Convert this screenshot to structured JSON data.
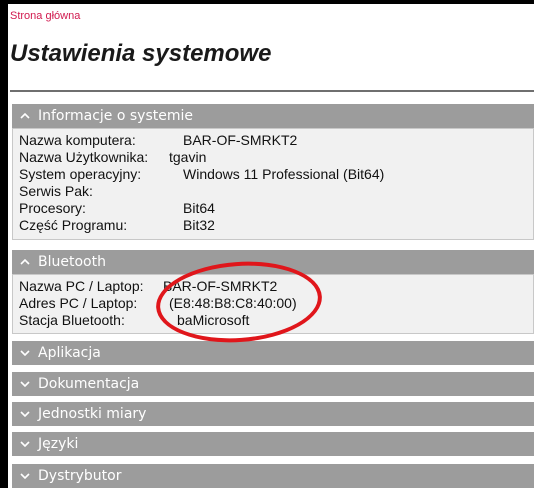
{
  "breadcrumb": "Strona główna",
  "page_title": "Ustawienia systemowe",
  "sections": [
    {
      "label": "Informacje o systemie",
      "expanded": true,
      "rows": [
        {
          "key": "Nazwa komputera:",
          "value": "BAR-OF-SMRKT2"
        },
        {
          "key": "Nazwa Użytkownika:",
          "value": "tgavin"
        },
        {
          "key": "System operacyjny:",
          "value": "Windows 11 Professional (Bit64)"
        },
        {
          "key": "Serwis Pak:",
          "value": ""
        },
        {
          "key": "Procesory:",
          "value": "Bit64"
        },
        {
          "key": "Część Programu:",
          "value": "Bit32"
        }
      ]
    },
    {
      "label": "Bluetooth",
      "expanded": true,
      "rows": [
        {
          "key": "Nazwa PC / Laptop:",
          "value": "BAR-OF-SMRKT2"
        },
        {
          "key": "Adres PC / Laptop:",
          "value": "(E8:48:B8:C8:40:00)"
        },
        {
          "key": "Stacja Bluetooth:",
          "value": "baMicrosoft"
        }
      ]
    },
    {
      "label": "Aplikacja",
      "expanded": false
    },
    {
      "label": "Dokumentacja",
      "expanded": false
    },
    {
      "label": "Jednostki miary",
      "expanded": false
    },
    {
      "label": "Języki",
      "expanded": false
    },
    {
      "label": "Dystrybutor",
      "expanded": false
    }
  ],
  "colors": {
    "header_bg": "#9c9c9c",
    "breadcrumb": "#d11a4f",
    "annotation": "#e0161b"
  },
  "icons": {
    "expanded": "chevron-up-icon",
    "collapsed": "chevron-down-icon"
  }
}
